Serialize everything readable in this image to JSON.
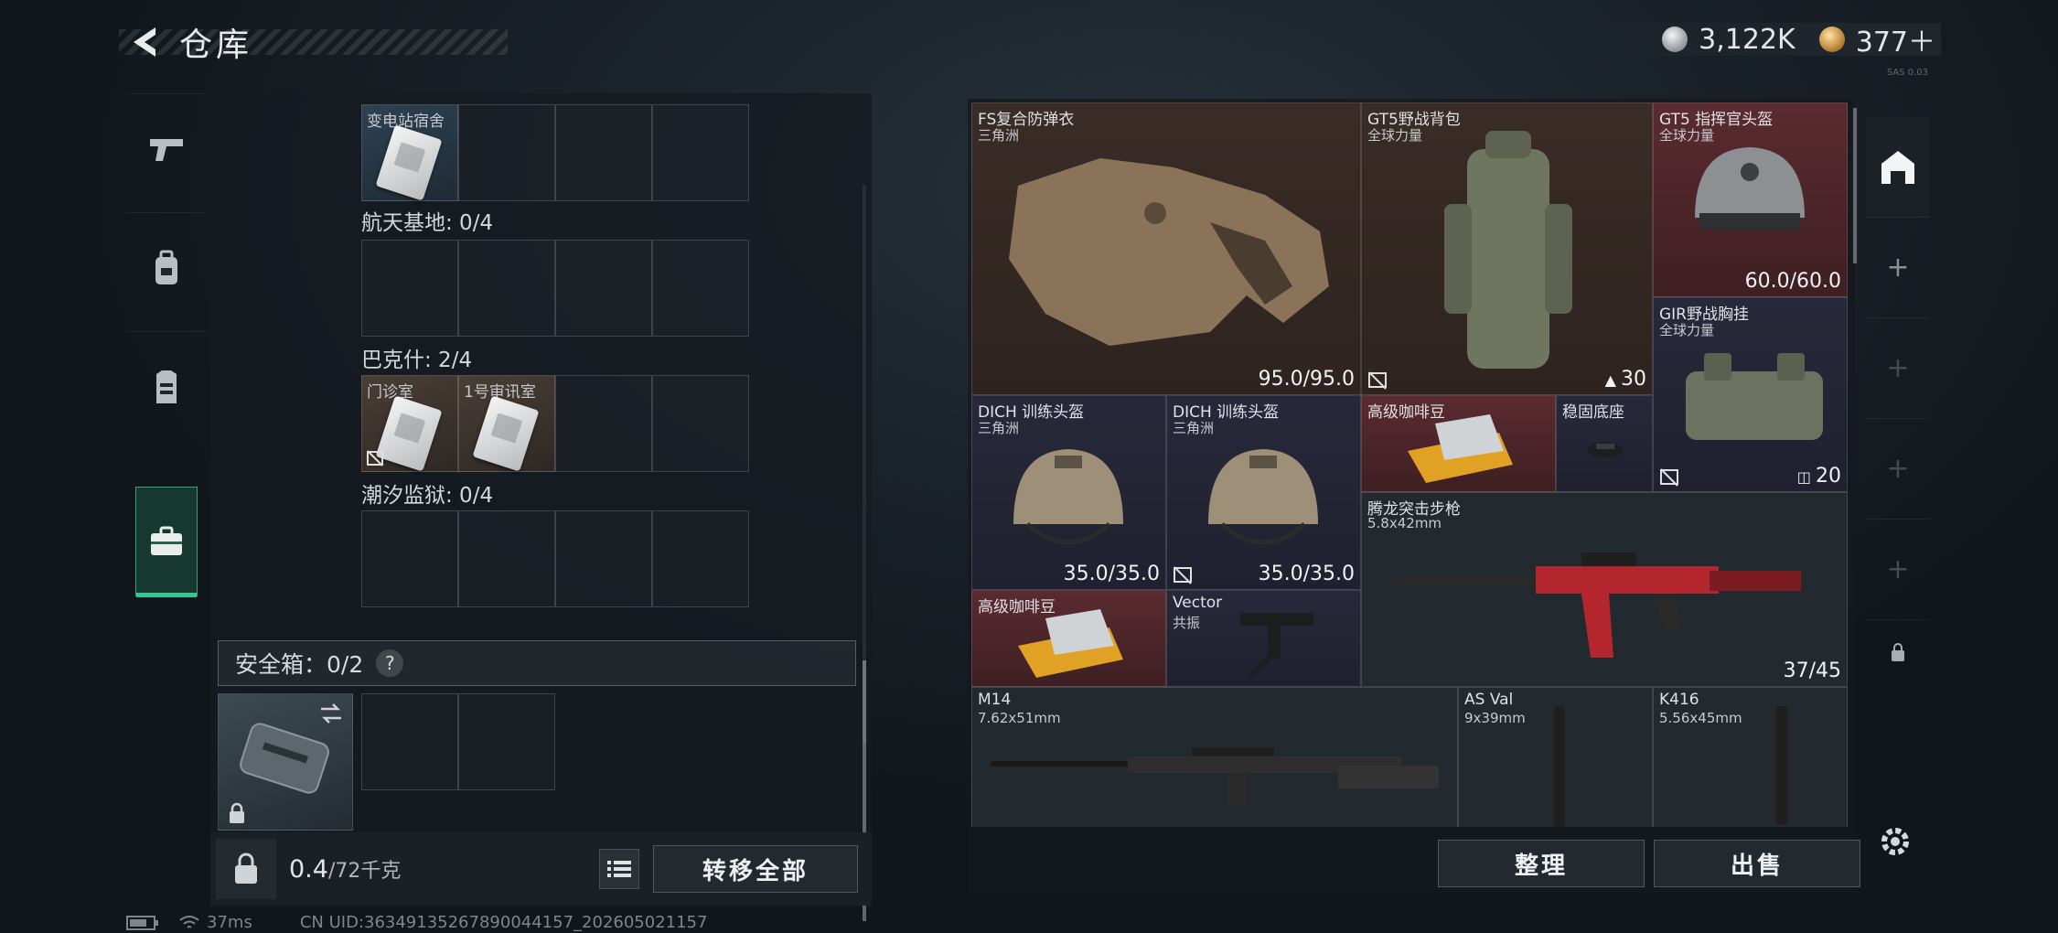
{
  "header": {
    "title": "仓库",
    "silver_amount": "3,122K",
    "gold_amount": "377＋",
    "version_text": "SAS 0.03"
  },
  "sidenav": {
    "items": [
      {
        "icon": "pistol-icon"
      },
      {
        "icon": "backpack-icon"
      },
      {
        "icon": "vest-icon"
      },
      {
        "icon": "briefcase-icon",
        "active": true
      }
    ]
  },
  "keys": {
    "top_slot_label": "变电站宿舍",
    "groups": [
      {
        "label": "航天基地: 0/4",
        "slots": []
      },
      {
        "label": "巴克什: 2/4",
        "slots": [
          "门诊室",
          "1号审讯室"
        ]
      },
      {
        "label": "潮汐监狱: 0/4",
        "slots": []
      }
    ]
  },
  "safebox": {
    "label": "安全箱：0/2",
    "help": "?"
  },
  "bottom": {
    "weight_value": "0.4",
    "weight_unit": "/72千克",
    "transfer_all": "转移全部"
  },
  "actions": {
    "sort": "整理",
    "sell": "出售"
  },
  "items": [
    {
      "name": "FS复合防弹衣",
      "sub": "三角洲",
      "value": "95.0/95.0"
    },
    {
      "name": "GT5野战背包",
      "sub": "全球力量",
      "value": "30"
    },
    {
      "name": "GT5 指挥官头盔",
      "sub": "全球力量",
      "value": "60.0/60.0"
    },
    {
      "name": "GIR野战胸挂",
      "sub": "全球力量",
      "value": "20"
    },
    {
      "name": "DICH 训练头盔",
      "sub": "三角洲",
      "value": "35.0/35.0"
    },
    {
      "name": "DICH 训练头盔",
      "sub": "三角洲",
      "value": "35.0/35.0"
    },
    {
      "name": "高级咖啡豆",
      "sub": "",
      "value": ""
    },
    {
      "name": "稳固底座",
      "sub": "",
      "value": ""
    },
    {
      "name": "腾龙突击步枪",
      "sub": "5.8x42mm",
      "value": "37/45"
    },
    {
      "name": "高级咖啡豆",
      "sub": "",
      "value": ""
    },
    {
      "name": "Vector",
      "sub": "共振",
      "value": ""
    },
    {
      "name": "M14",
      "sub": "7.62x51mm",
      "value": ""
    },
    {
      "name": "AS Val",
      "sub": "9x39mm",
      "value": ""
    },
    {
      "name": "K416",
      "sub": "5.56x45mm",
      "value": ""
    }
  ],
  "status": {
    "ping": "37ms",
    "uid": "CN UID:36349135267890044157_202605021157"
  },
  "colors": {
    "accent_green": "#36c593",
    "panel_red": "#5a2b30",
    "panel_brown": "#3a2c27",
    "panel_blue": "#27293a"
  }
}
